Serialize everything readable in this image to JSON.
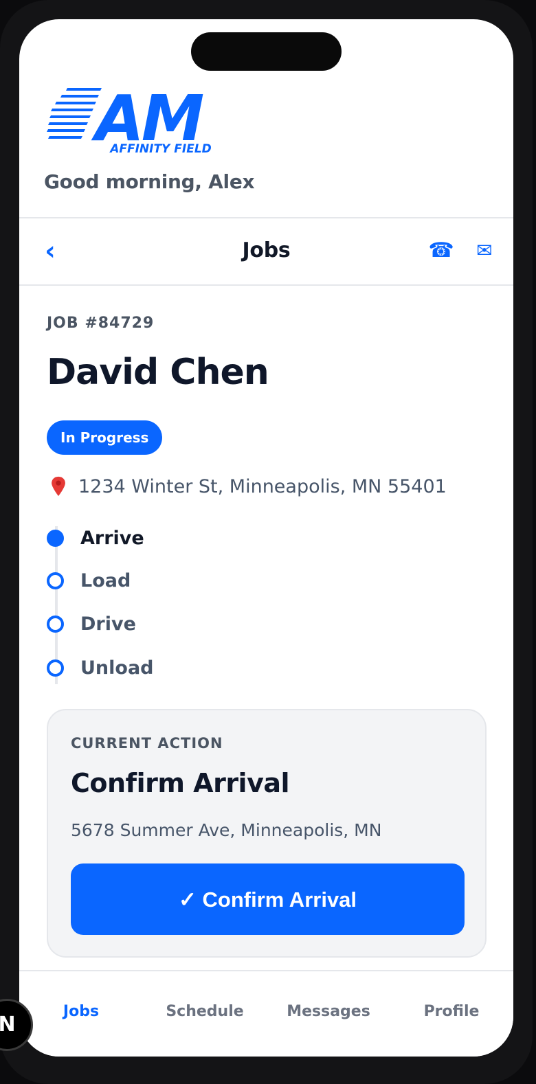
{
  "brand": {
    "logo_text": "AM",
    "logo_subtext": "AFFINITY FIELD",
    "color": "#0a66ff"
  },
  "header": {
    "greeting": "Good morning, Alex"
  },
  "nav": {
    "back_icon": "chevron-left-icon",
    "back_glyph": "‹",
    "title": "Jobs",
    "phone_icon": "phone-icon",
    "phone_glyph": "☎",
    "mail_icon": "mail-icon",
    "mail_glyph": "✉"
  },
  "job": {
    "number": "JOB #84729",
    "customer": "David Chen",
    "status": "In Progress",
    "status_color": "#0a66ff",
    "address_icon": "map-pin-icon",
    "address": "1234 Winter St, Minneapolis, MN 55401"
  },
  "steps": [
    {
      "label": "Arrive",
      "active": true
    },
    {
      "label": "Load",
      "active": false
    },
    {
      "label": "Drive",
      "active": false
    },
    {
      "label": "Unload",
      "active": false
    }
  ],
  "current_action": {
    "overline": "CURRENT ACTION",
    "title": "Confirm Arrival",
    "address": "5678 Summer Ave, Minneapolis, MN",
    "button_label": "✓ Confirm Arrival"
  },
  "tabs": [
    {
      "label": "Jobs",
      "active": true
    },
    {
      "label": "Schedule",
      "active": false
    },
    {
      "label": "Messages",
      "active": false
    },
    {
      "label": "Profile",
      "active": false
    }
  ],
  "floating_badge": {
    "label": "N"
  }
}
